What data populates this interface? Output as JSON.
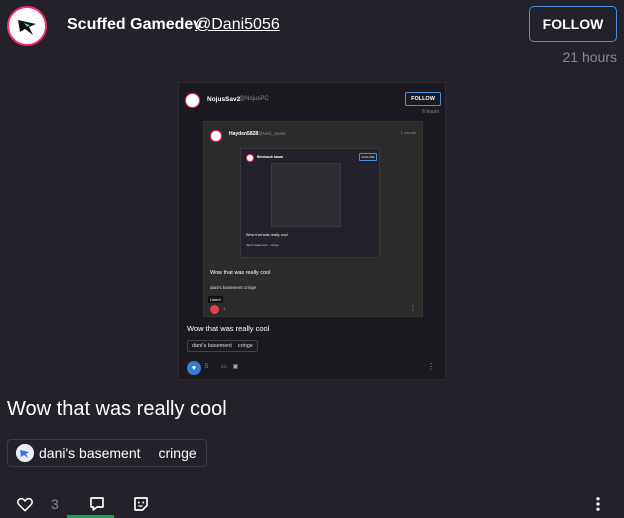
{
  "post": {
    "author_name": "Scuffed Gamedev",
    "author_handle": "@Dani5056",
    "follow_label": "FOLLOW",
    "timestamp": "21 hours",
    "text": "Wow that was really cool",
    "tags": [
      {
        "label": "dani's basement",
        "icon": "community-avatar-icon"
      },
      {
        "label": "cringe"
      }
    ],
    "like_count": "3",
    "colors": {
      "background": "#232129",
      "accent": "#4a8fe0",
      "avatar_ring": "#ff2a6b",
      "active_tab": "#1aa34a"
    }
  },
  "embed": {
    "author_name": "NojusSav2",
    "author_handle": "@NojusPC",
    "follow_label": "FOLLOW",
    "timestamp": "6 hours",
    "text": "Wow that was really cool",
    "tags": [
      "dani's basement",
      "cringe"
    ],
    "like_count": "5",
    "nested": {
      "author_name": "Hayden5828",
      "author_handle": "@Nick_Javier",
      "timestamp": "1 minute",
      "text": "Wow that was really cool",
      "tags": [
        "dani's basement",
        "cringe"
      ],
      "tooltip": "Liked!",
      "like_count": "1",
      "nested": {
        "author_name": "Bleebaub baum",
        "follow_label": "FOLLOW",
        "text": "Wow that was really cool",
        "tags": [
          "dani's basement",
          "cringe"
        ]
      }
    }
  }
}
